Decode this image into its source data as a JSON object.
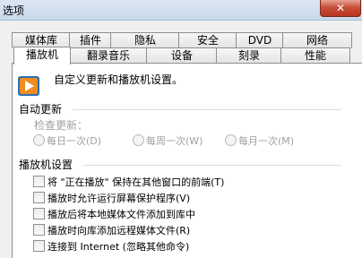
{
  "window": {
    "title": "选项",
    "close_glyph": "✕"
  },
  "tabs_row1": [
    "媒体库",
    "插件",
    "隐私",
    "安全",
    "DVD",
    "网络"
  ],
  "tabs_row2": [
    "播放机",
    "翻录音乐",
    "设备",
    "刻录",
    "性能"
  ],
  "active_tab": "播放机",
  "description": "自定义更新和播放机设置。",
  "auto_update": {
    "group_title": "自动更新",
    "check_label": "检查更新：",
    "options": [
      "每日一次(D)",
      "每周一次(W)",
      "每月一次(M)"
    ]
  },
  "player_settings": {
    "group_title": "播放机设置",
    "checkboxes": [
      "将 \"正在播放\" 保持在其他窗口的前端(T)",
      "播放时允许运行屏幕保护程序(V)",
      "播放后将本地媒体文件添加到库中",
      "播放时向库添加远程媒体文件(R)",
      "连接到 Internet (忽略其他命令)"
    ]
  },
  "colors": {
    "accent_orange": "#f08c1e",
    "titlebar": "#c9d9ec",
    "close_red": "#c9503a"
  }
}
